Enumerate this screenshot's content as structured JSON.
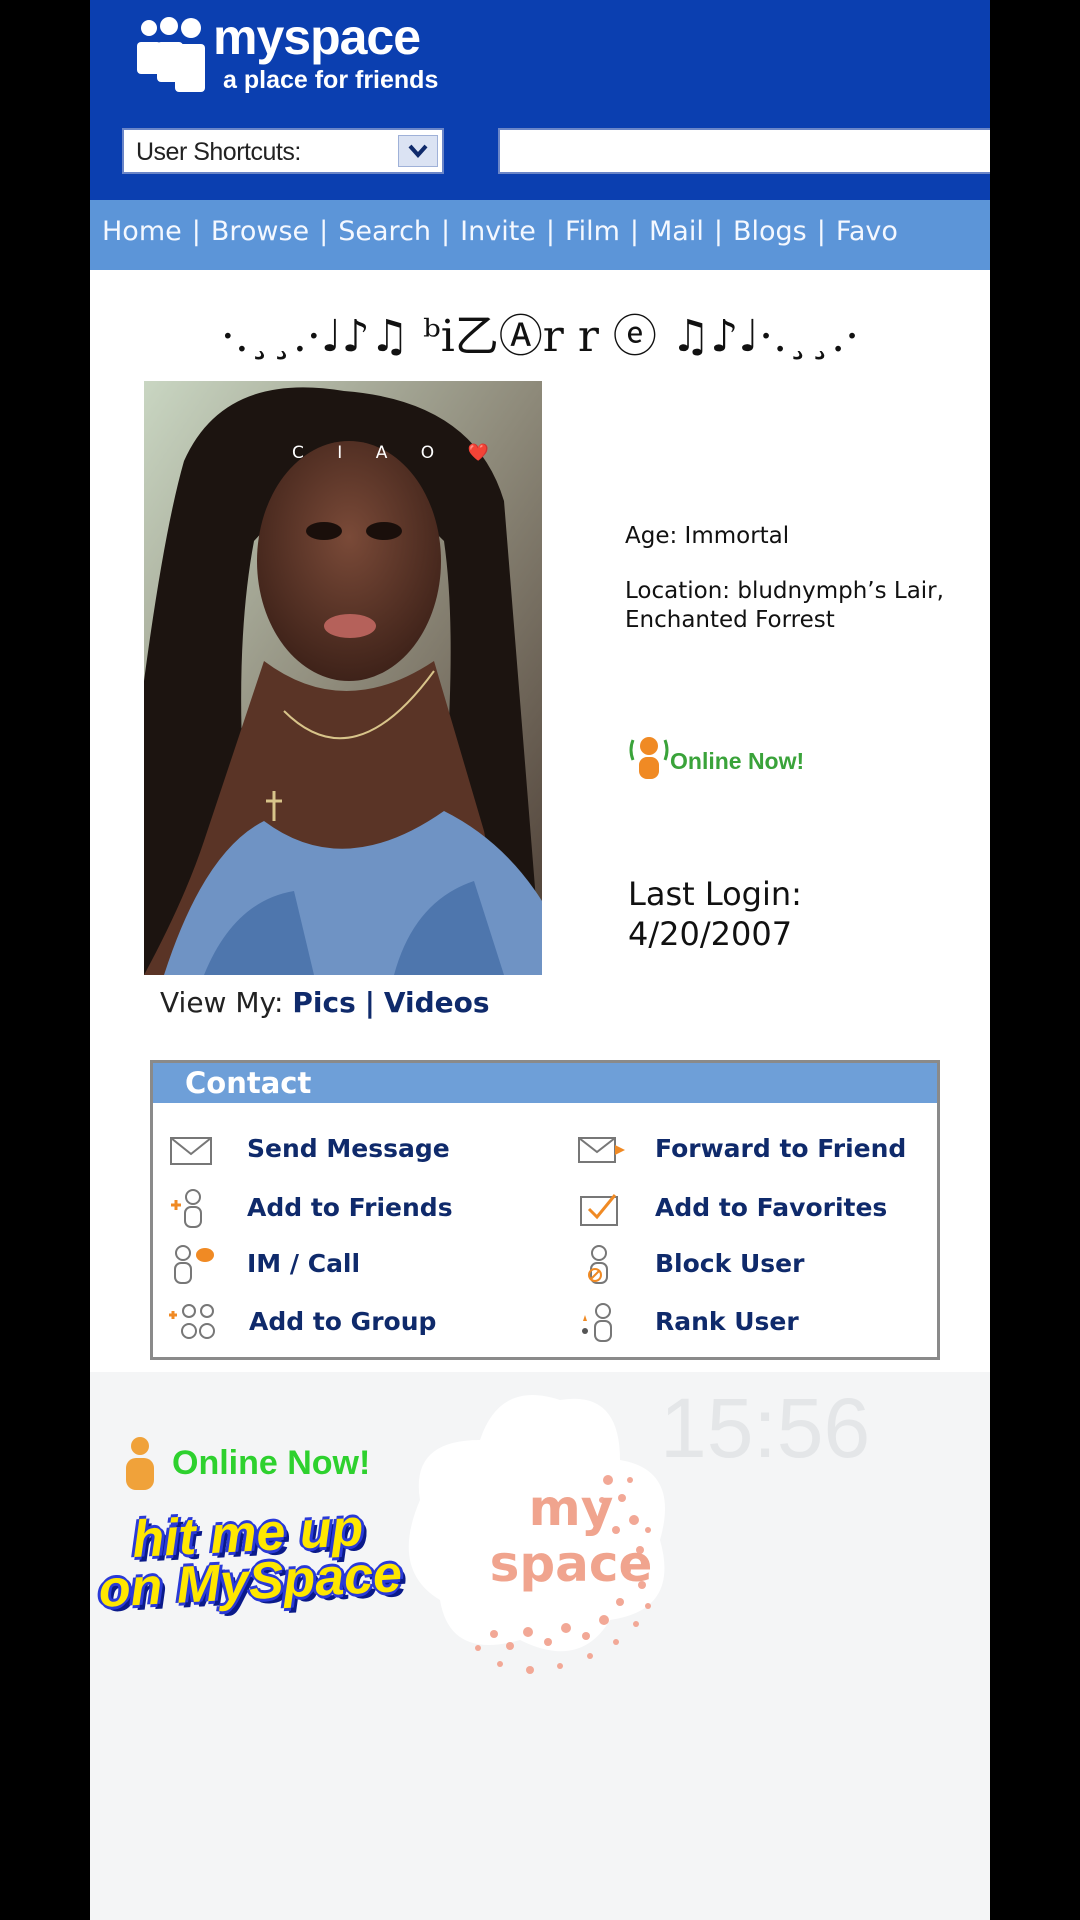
{
  "header": {
    "logo_text": "myspace",
    "tagline": "a place for friends",
    "shortcuts_label": "User Shortcuts:",
    "search_value": ""
  },
  "nav": {
    "items": [
      "Home",
      "Browse",
      "Search",
      "Invite",
      "Film",
      "Mail",
      "Blogs",
      "Favo"
    ]
  },
  "profile": {
    "title": "·.¸¸.·♩♪♫ ᵇi乙Ⓐr r ⓔ ♫♪♩·.¸¸.·",
    "photo_caption": "C I A O ❤️",
    "view_my_label": "View My:",
    "view_pics": "Pics",
    "view_sep": "|",
    "view_videos": "Videos",
    "age": "Age: Immortal",
    "location_line1": "Location: bludnymph’s Lair,",
    "location_line2": "Enchanted Forrest",
    "online_status": "Online Now!",
    "last_login_label": "Last Login:",
    "last_login_date": "4/20/2007"
  },
  "contact": {
    "title": "Contact",
    "items": [
      {
        "label": "Send Message",
        "icon": "envelope-icon"
      },
      {
        "label": "Forward to Friend",
        "icon": "forward-envelope-icon"
      },
      {
        "label": "Add to Friends",
        "icon": "add-friend-icon"
      },
      {
        "label": "Add to Favorites",
        "icon": "favorites-icon"
      },
      {
        "label": "IM / Call",
        "icon": "im-call-icon"
      },
      {
        "label": "Block User",
        "icon": "block-user-icon"
      },
      {
        "label": "Add to Group",
        "icon": "add-group-icon"
      },
      {
        "label": "Rank User",
        "icon": "rank-user-icon"
      }
    ]
  },
  "overlay": {
    "clock": "15:56",
    "online_sticker": "Online Now!",
    "hit_me_line1": "hit me up",
    "hit_me_line2": "on MySpace",
    "myspace_sticker_line1": "my",
    "myspace_sticker_line2": "space"
  },
  "colors": {
    "header_blue": "#0b3fb0",
    "nav_blue": "#5c95d8",
    "link_navy": "#0f2a6b",
    "online_green": "#3aa33a",
    "sticker_yellow": "#ffe700",
    "sticker_peach": "#f0a48e"
  }
}
